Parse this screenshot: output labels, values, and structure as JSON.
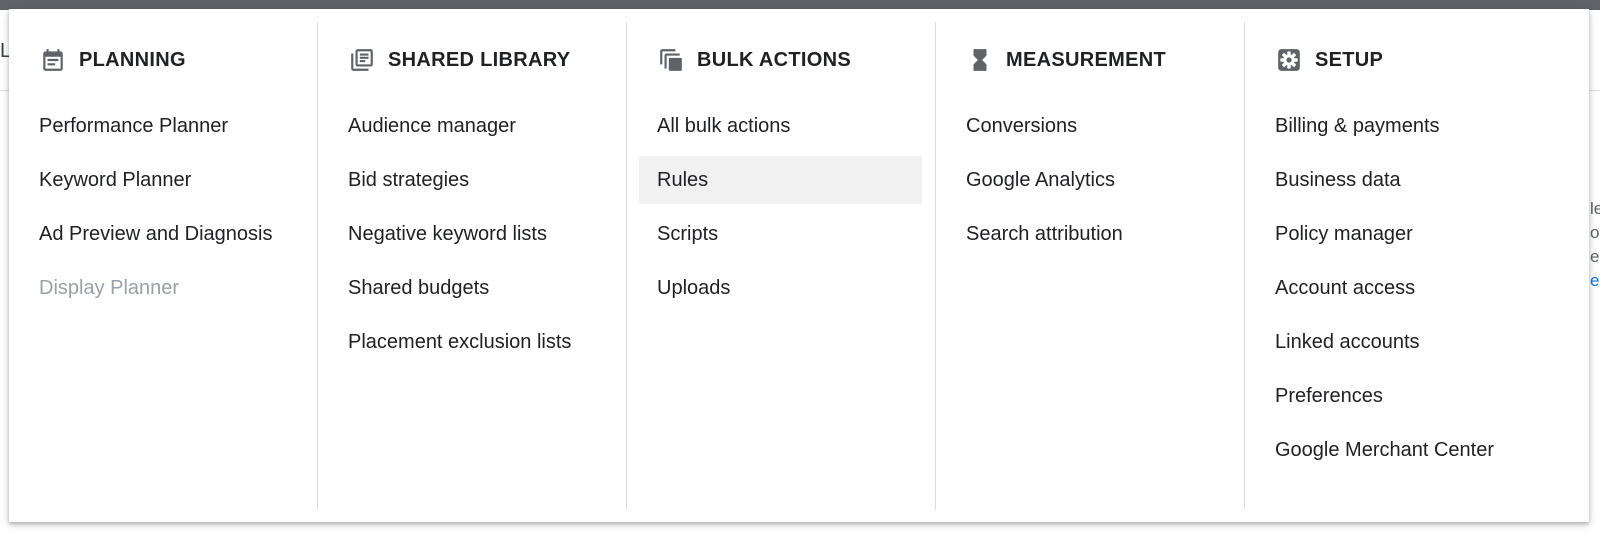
{
  "background": {
    "left_glyph": "L",
    "right_fragments": [
      "le",
      "os",
      "e",
      "e"
    ]
  },
  "colors": {
    "text": "#202124",
    "disabled": "#9aa0a6",
    "highlight": "#f1f1f1",
    "icon": "#5f6368",
    "divider": "#dadce0"
  },
  "columns": [
    {
      "title": "PLANNING",
      "icon": "calendar-icon",
      "items": [
        {
          "label": "Performance Planner"
        },
        {
          "label": "Keyword Planner"
        },
        {
          "label": "Ad Preview and Diagnosis"
        },
        {
          "label": "Display Planner",
          "disabled": true
        }
      ]
    },
    {
      "title": "SHARED LIBRARY",
      "icon": "library-icon",
      "items": [
        {
          "label": "Audience manager"
        },
        {
          "label": "Bid strategies"
        },
        {
          "label": "Negative keyword lists"
        },
        {
          "label": "Shared budgets"
        },
        {
          "label": "Placement exclusion lists"
        }
      ]
    },
    {
      "title": "BULK ACTIONS",
      "icon": "copy-stack-icon",
      "items": [
        {
          "label": "All bulk actions"
        },
        {
          "label": "Rules",
          "highlighted": true
        },
        {
          "label": "Scripts"
        },
        {
          "label": "Uploads"
        }
      ]
    },
    {
      "title": "MEASUREMENT",
      "icon": "hourglass-icon",
      "items": [
        {
          "label": "Conversions"
        },
        {
          "label": "Google Analytics"
        },
        {
          "label": "Search attribution"
        }
      ]
    },
    {
      "title": "SETUP",
      "icon": "gear-icon",
      "items": [
        {
          "label": "Billing & payments"
        },
        {
          "label": "Business data"
        },
        {
          "label": "Policy manager"
        },
        {
          "label": "Account access"
        },
        {
          "label": "Linked accounts"
        },
        {
          "label": "Preferences"
        },
        {
          "label": "Google Merchant Center"
        }
      ]
    }
  ]
}
